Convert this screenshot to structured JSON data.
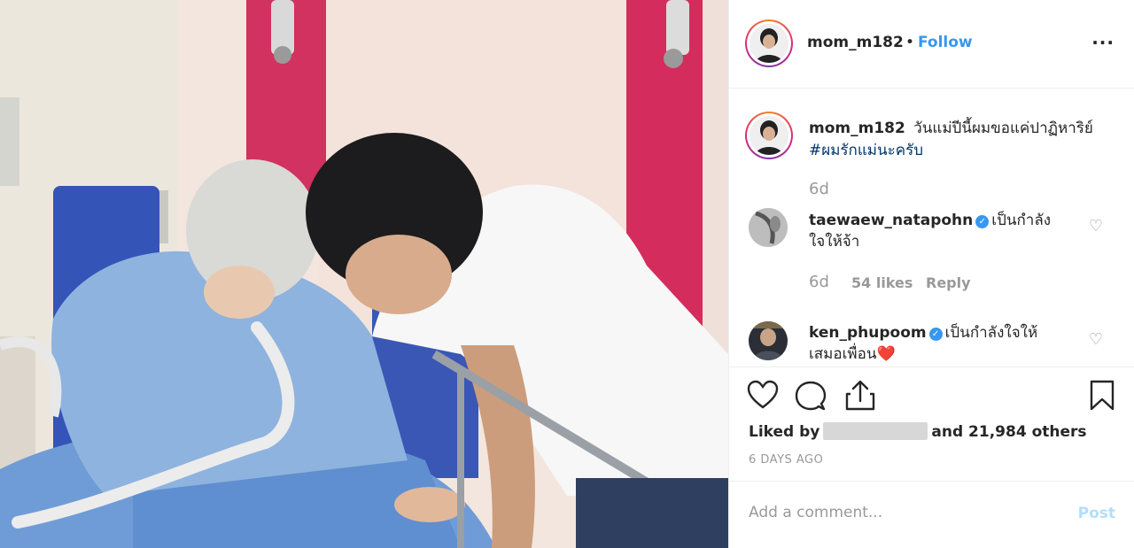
{
  "post": {
    "author": "mom_m182",
    "follow_label": "Follow",
    "more_label": "···",
    "caption_text": "วันแม่ปีนี้ผมขอแค่ปาฏิหาริย์",
    "caption_hashtag": "#ผมรักแม่นะครับ",
    "caption_time": "6d"
  },
  "comments": [
    {
      "username": "taewaew_natapohn",
      "verified": true,
      "text": "เป็นกำลังใจให้จ้า",
      "time": "6d",
      "likes": "54 likes",
      "reply": "Reply"
    },
    {
      "username": "ken_phupoom",
      "verified": true,
      "text": "เป็นกำลังใจให้เสมอเพื่อน❤️"
    }
  ],
  "likes": {
    "prefix": "Liked by",
    "suffix": "and 21,984 others"
  },
  "timestamp": "6 DAYS AGO",
  "add_comment": {
    "placeholder": "Add a comment...",
    "post_label": "Post"
  },
  "colors": {
    "link": "#3897f0",
    "hashtag": "#003569",
    "muted": "#999999",
    "post_disabled": "#b2dffc"
  }
}
